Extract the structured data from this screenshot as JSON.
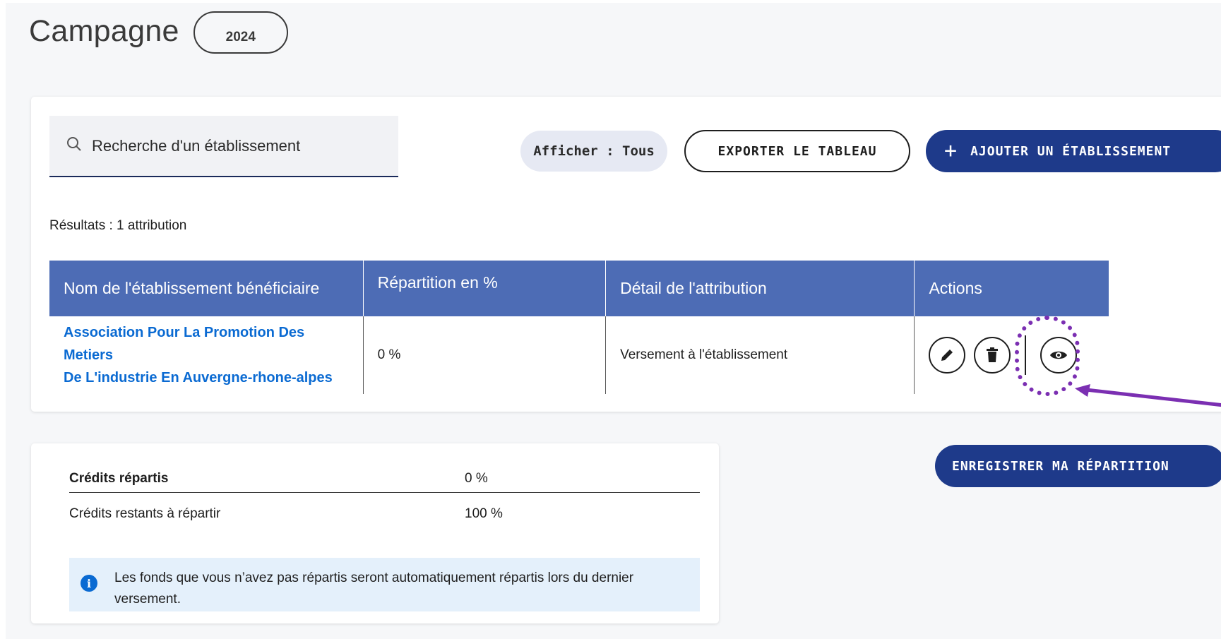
{
  "header": {
    "title": "Campagne",
    "year": "2024"
  },
  "search": {
    "placeholder": "Recherche d'un établissement"
  },
  "toolbar": {
    "filter_label": "Afficher : Tous",
    "export_label": "EXPORTER LE TABLEAU",
    "add_label": "AJOUTER UN ÉTABLISSEMENT"
  },
  "results": {
    "text": "Résultats : 1 attribution"
  },
  "table": {
    "columns": [
      "Nom de l'établissement bénéficiaire",
      "Répartition en %",
      "Détail de l'attribution",
      "Actions"
    ],
    "rows": [
      {
        "name_line1": "Association Pour La Promotion Des Metiers",
        "name_line2": "De L'industrie En Auvergne-rhone-alpes",
        "repartition": "0 %",
        "detail": "Versement à l'établissement"
      }
    ]
  },
  "credits": {
    "repartis_label": "Crédits répartis",
    "repartis_value": "0 %",
    "restants_label": "Crédits restants à répartir",
    "restants_value": "100 %",
    "info_text": "Les fonds que vous n’avez pas répartis seront automatiquement répartis lors du dernier versement."
  },
  "save": {
    "label": "ENREGISTRER MA RÉPARTITION"
  },
  "colors": {
    "primary": "#1e3a8a",
    "table_header": "#4d6cb5",
    "link": "#0a6ad2",
    "annotation": "#7b2fb2"
  },
  "icons": [
    "search-icon",
    "plus-icon",
    "edit-pencil-icon",
    "trash-icon",
    "eye-icon",
    "info-icon"
  ]
}
